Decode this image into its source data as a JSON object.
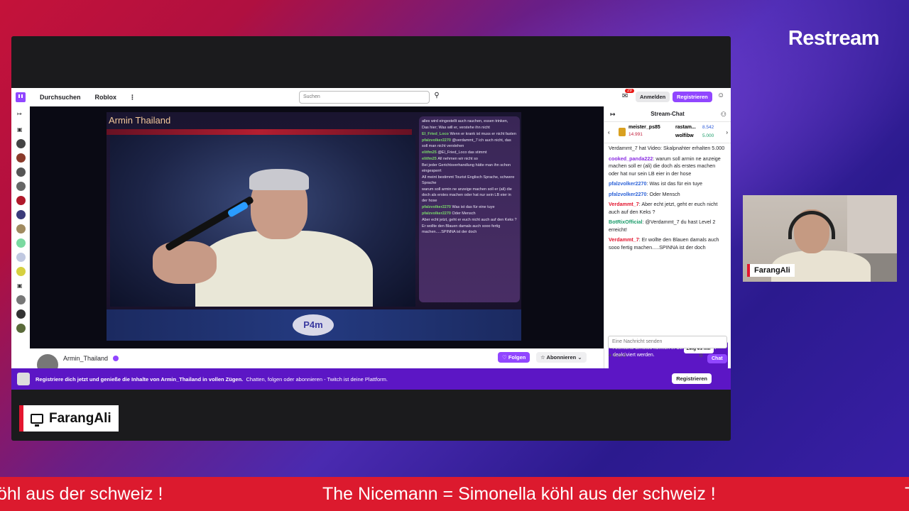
{
  "brand": "Restream",
  "twitch": {
    "nav": {
      "browse_label": "Durchsuchen",
      "roblox_label": "Roblox",
      "more_label": "⋮",
      "search_placeholder": "Suchen",
      "inbox_count": "29",
      "login_label": "Anmelden",
      "register_label": "Registrieren"
    },
    "stream": {
      "overlay_title": "Armin Thailand",
      "logo_text": "P4m",
      "overlay_chat": [
        {
          "user": "",
          "text": "alles wird eingestellt auch rauchen, essen trinken,"
        },
        {
          "user": "",
          "text": "Das hier; Was will er, verstehe ihn nicht"
        },
        {
          "user": "El_Fried_Loco",
          "text": "Wenn er krank ist muss er nicht fasten"
        },
        {
          "user": "pfalzvolker2270",
          "text": "@verdammt_7 ich auch nicht, das soll man nicht verstehen"
        },
        {
          "user": "elitfm25",
          "text": "@El_Fried_Loco das stimmt"
        },
        {
          "user": "elitfm25",
          "text": "All nehmen wir nicht so"
        },
        {
          "user": "",
          "text": "Bei jeder Gerichtsverhandlung hätte man ihn schon eingesperrt"
        },
        {
          "user": "",
          "text": "All meint bestimmt Tourist Englisch Sprache, schwere Sprache"
        },
        {
          "user": "",
          "text": "warum soll armin ne anzeige machen soll er (ali) die doch als erstes machen oder hat nur sein LB eier in der hose"
        },
        {
          "user": "pfalzvolker2270",
          "text": "Was ist das für eine tuye"
        },
        {
          "user": "pfalzvolker2270",
          "text": "Oder Mensch"
        },
        {
          "user": "",
          "text": "Aber echt jetzt, geht er euch nicht auch auf den Keks ?"
        },
        {
          "user": "",
          "text": "Er wollte den Blauen damals auch sooo fertig machen.....SPINNA ist der doch"
        }
      ]
    },
    "channel": {
      "name": "Armin_Thailand",
      "follow_label": "Folgen",
      "subscribe_label": "Abonnieren"
    },
    "chat": {
      "header": "Stream-Chat",
      "gifts": {
        "top_user": "meister_ps85",
        "top_value": "14.991",
        "user2": "rastam...",
        "value2": "8.542",
        "user3": "wolfibw",
        "value3": "5.000"
      },
      "messages": [
        {
          "user": "",
          "text": "Verdammt_7 hat Video: Skalpnahter erhalten 5.000"
        },
        {
          "user": "cooked_panda222",
          "text": ": warum soll armin ne anzeige machen soll er (ali) die doch als erstes machen oder hat nur sein LB eier in der hose",
          "color": "#8a2be2"
        },
        {
          "user": "pfalzvolker2270",
          "text": ": Was ist das für ein tuye",
          "color": "#2d63d8"
        },
        {
          "user": "pfalzvolker2270",
          "text": ": Oder Mensch",
          "color": "#2d63d8"
        },
        {
          "user": "Verdammt_7",
          "text": ": Aber echt jetzt, geht er euch nicht auch auf den Keks ?",
          "color": "#e3162f"
        },
        {
          "user": "BotRixOfficial",
          "text": ": @Verdammt_7 du hast Level 2 erreicht!",
          "color": "#1b9c6a"
        },
        {
          "user": "Verdammt_7",
          "text": ": Er wollte den Blauen damals auch sooo fertig machen.....SPINNA ist der doch",
          "color": "#e3162f"
        }
      ],
      "notice": "Animierte Emotes können in den Einstellungen deaktiviert werden.",
      "notice_button": "Zeig es mir",
      "input_placeholder": "Eine Nachricht senden",
      "points_a": "0",
      "points_b": "0",
      "chat_button": "Chat"
    },
    "banner": {
      "prefix": "Registriere dich jetzt und genieße die Inhalte von Armin_Thailand in vollen Zügen.",
      "suffix": "Chatten, folgen oder abonnieren - Twitch ist deine Plattform.",
      "button": "Registrieren"
    }
  },
  "screen_tag": "FarangAli",
  "webcam_tag": "FarangAli",
  "ticker": {
    "left": "öhl aus der schweiz !",
    "main": "The Nicemann = Simonella köhl aus der schweiz !",
    "right": "T"
  }
}
